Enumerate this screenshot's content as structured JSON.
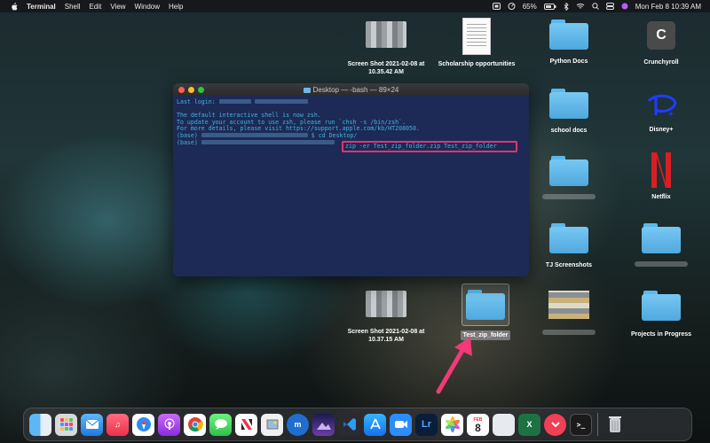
{
  "menubar": {
    "app": "Terminal",
    "menus": [
      "Shell",
      "Edit",
      "View",
      "Window",
      "Help"
    ],
    "battery": "65%",
    "datetime": "Mon Feb 8  10:39 AM"
  },
  "desktop": {
    "icons": [
      {
        "id": "screenshot1",
        "label": "Screen Shot 2021-02-08 at 10.35.42 AM"
      },
      {
        "id": "scholarship",
        "label": "Scholarship opportunities"
      },
      {
        "id": "python",
        "label": "Python Docs"
      },
      {
        "id": "crunchyroll",
        "label": "Crunchyroll"
      },
      {
        "id": "school",
        "label": "school docs"
      },
      {
        "id": "disney",
        "label": "Disney+"
      },
      {
        "id": "netflix",
        "label": "Netflix"
      },
      {
        "id": "tj",
        "label": "TJ Screenshots"
      },
      {
        "id": "screenshot2",
        "label": "Screen Shot 2021-02-08 at 10.37.15 AM"
      },
      {
        "id": "testzip",
        "label": "Test_zip_folder"
      },
      {
        "id": "projects",
        "label": "Projects in Progress"
      }
    ]
  },
  "terminal": {
    "title": "Desktop — -bash — 89×24",
    "lines": {
      "login": "Last login:",
      "l2": "The default interactive shell is now zsh.",
      "l3": "To update your account to use zsh, please run `chsh -s /bin/zsh`.",
      "l4": "For more details, please visit https://support.apple.com/kb/HT208050.",
      "l5_prompt": "(base)",
      "l5_cmd": "$ cd Desktop/",
      "l6_prompt": "(base)",
      "l6_cmd": "zip -er Test_zip_folder.zip Test_zip_folder"
    }
  },
  "dock": {
    "items": [
      "finder",
      "launchpad",
      "mail",
      "music",
      "safari",
      "podcasts",
      "chrome",
      "messages",
      "news",
      "preview",
      "musescore",
      "night",
      "vscode",
      "app-store",
      "zoom",
      "lightroom",
      "photos",
      "calendar",
      "finder-alt",
      "excel",
      "pocket",
      "terminal",
      "trash"
    ],
    "calendar_month": "FEB",
    "calendar_day": "8",
    "lightroom_label": "Lr"
  },
  "colors": {
    "terminal_bg": "#1c2a55",
    "terminal_text": "#43b3e0",
    "highlight": "#e6336e",
    "folder": "#5ab8ec"
  }
}
